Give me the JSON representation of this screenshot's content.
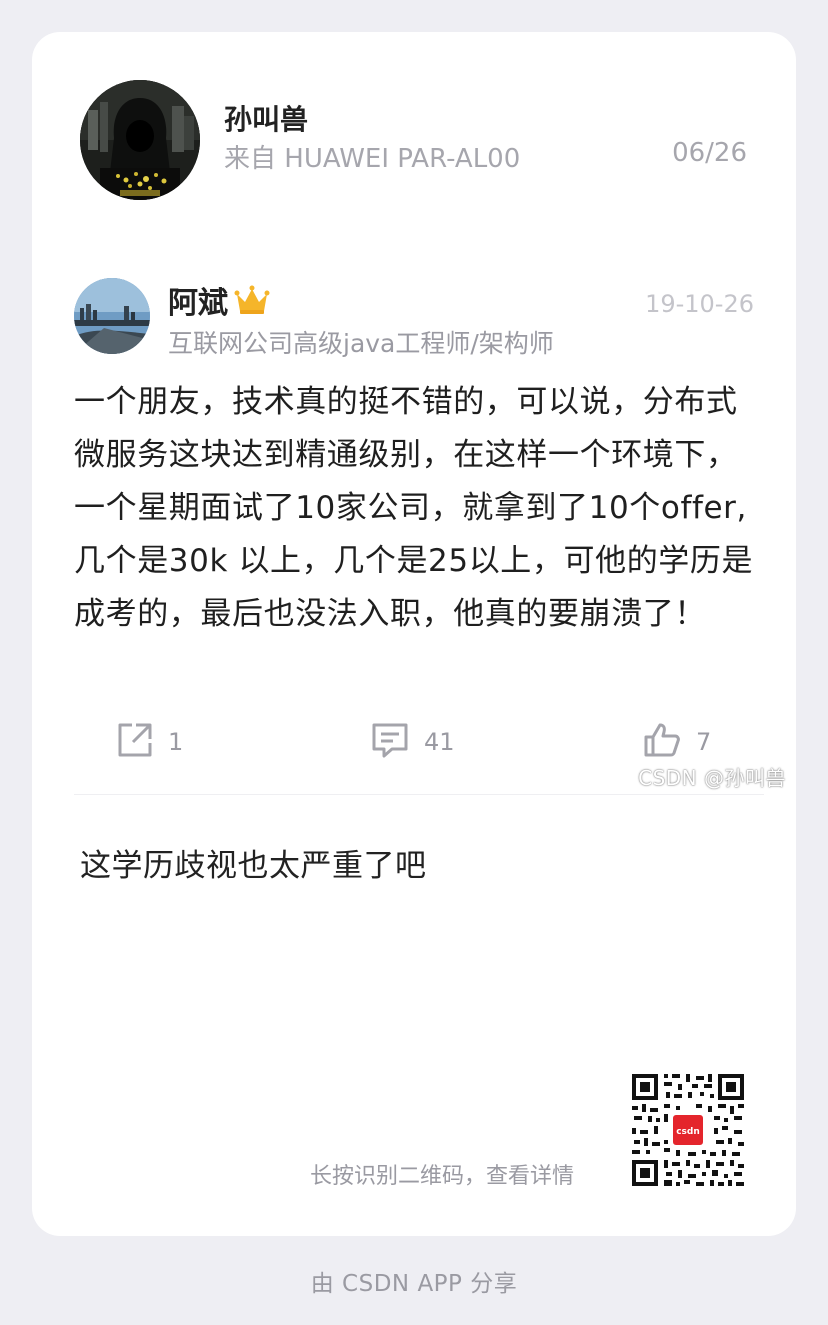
{
  "sharer": {
    "name": "孙叫兽",
    "device": "来自 HUAWEI PAR-AL00",
    "date": "06/26",
    "avatar_icon": "hooded-hacker-avatar"
  },
  "post": {
    "author_name": "阿斌",
    "badge_icon": "crown-icon",
    "time": "19-10-26",
    "author_title": "互联网公司高级java工程师/架构师",
    "content": "一个朋友，技术真的挺不错的，可以说，分布式微服务这块达到精通级别，在这样一个环境下，一个星期面试了10家公司，就拿到了10个offer, 几个是30k 以上，几个是25以上，可他的学历是成考的，最后也没法入职，他真的要崩溃了！",
    "actions": {
      "share_count": "1",
      "comment_count": "41",
      "like_count": "7"
    },
    "watermark": "CSDN @孙叫兽"
  },
  "comment": {
    "text": "这学历歧视也太严重了吧"
  },
  "qr": {
    "hint": "长按识别二维码，查看详情",
    "center_label": "csdn"
  },
  "footer": {
    "text": "由 CSDN APP 分享"
  },
  "colors": {
    "background": "#eeeef3",
    "card": "#ffffff",
    "muted_text": "#9a9aa2",
    "crown": "#f5b52a",
    "csdn_red": "#e4252c"
  }
}
